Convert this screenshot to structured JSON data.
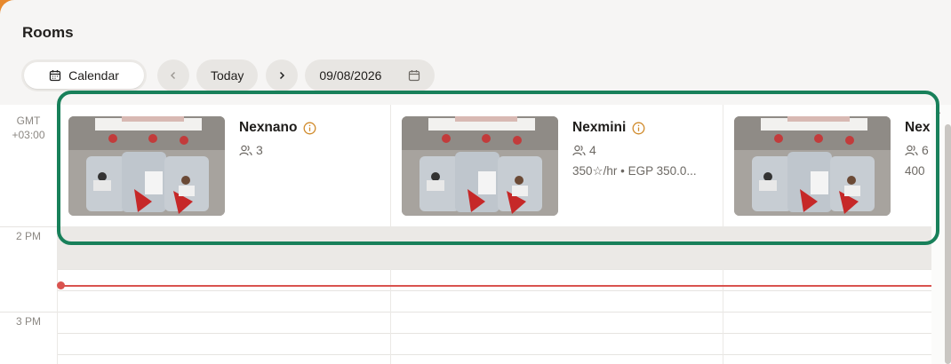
{
  "page": {
    "title": "Rooms"
  },
  "toolbar": {
    "calendar_label": "Calendar",
    "prev_icon": "chevron-left-icon",
    "today_label": "Today",
    "next_icon": "chevron-right-icon",
    "date_value": "09/08/2026",
    "date_icon": "calendar-icon"
  },
  "timezone": {
    "line1": "GMT",
    "line2": "+03:00"
  },
  "rooms": [
    {
      "name": "Nexnano",
      "capacity": "3",
      "rate": "",
      "info_icon": "info-icon"
    },
    {
      "name": "Nexmini",
      "capacity": "4",
      "rate": "350☆/hr • EGP 350.0...",
      "info_icon": "info-icon"
    },
    {
      "name": "Nex",
      "capacity": "6",
      "rate": "400",
      "info_icon": ""
    }
  ],
  "hours": [
    "2 PM",
    "3 PM"
  ],
  "colors": {
    "accent_orange": "#e7892d",
    "highlight_green": "#18805a",
    "now_line": "#d9534f"
  }
}
